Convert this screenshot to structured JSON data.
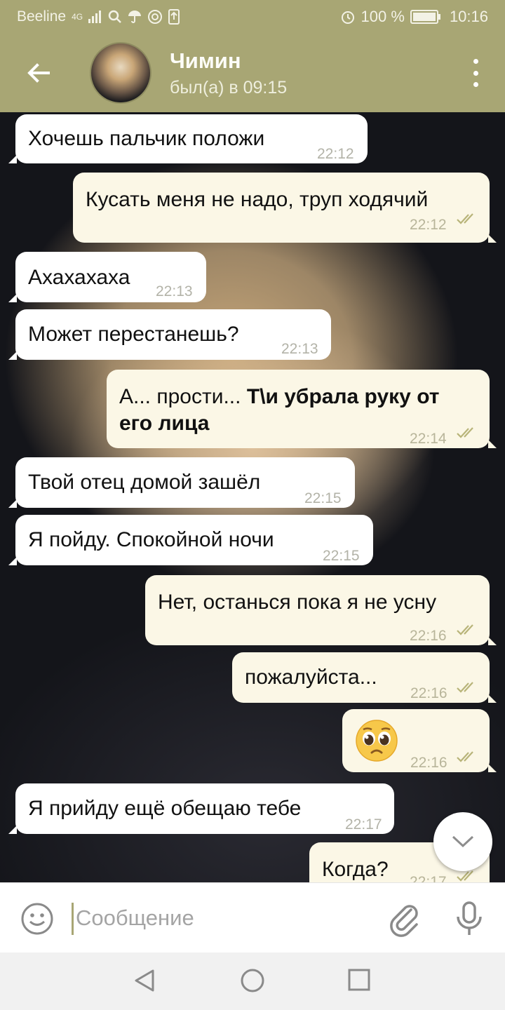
{
  "status_bar": {
    "carrier": "Beeline",
    "network": "4G",
    "battery": "100 %",
    "time": "10:16"
  },
  "header": {
    "name": "Чимин",
    "status": "был(а) в 09:15"
  },
  "messages": [
    {
      "dir": "in",
      "text": "Хочешь пальчик положи",
      "time": "22:12"
    },
    {
      "dir": "out",
      "text": "Кусать меня не надо, труп ходячий",
      "time": "22:12",
      "read": true
    },
    {
      "dir": "in",
      "text": "Ахахахаха",
      "time": "22:13"
    },
    {
      "dir": "in",
      "text": "Может перестанешь?",
      "time": "22:13"
    },
    {
      "dir": "out",
      "text_plain": "А... прости... ",
      "text_bold_1": "Т\\и убрала руку от",
      "text_bold_2": "его лица",
      "time": "22:14",
      "read": true
    },
    {
      "dir": "in",
      "text": "Твой отец домой зашёл",
      "time": "22:15"
    },
    {
      "dir": "in",
      "text": "Я пойду. Спокойной ночи",
      "time": "22:15"
    },
    {
      "dir": "out",
      "text": "Нет, останься пока я не усну",
      "time": "22:16",
      "read": true
    },
    {
      "dir": "out",
      "text": "пожалуйста...",
      "time": "22:16",
      "read": true
    },
    {
      "dir": "out",
      "text": "🥺",
      "time": "22:16",
      "read": true
    },
    {
      "dir": "in",
      "text": "Я прийду ещё обещаю тебе",
      "time": "22:17"
    },
    {
      "dir": "out",
      "text": "Когда?",
      "time": "22:17",
      "read": true
    }
  ],
  "input": {
    "placeholder": "Сообщение"
  },
  "colors": {
    "header": "#a8a674",
    "incoming_bubble": "#ffffff",
    "outgoing_bubble": "#fbf7e6",
    "read_ticks": "#b8b479"
  },
  "icons": [
    "back-arrow-icon",
    "more-vert-icon",
    "scroll-down-chevron-icon",
    "emoji-icon",
    "attach-icon",
    "mic-icon",
    "nav-back-icon",
    "nav-home-icon",
    "nav-recent-icon"
  ]
}
